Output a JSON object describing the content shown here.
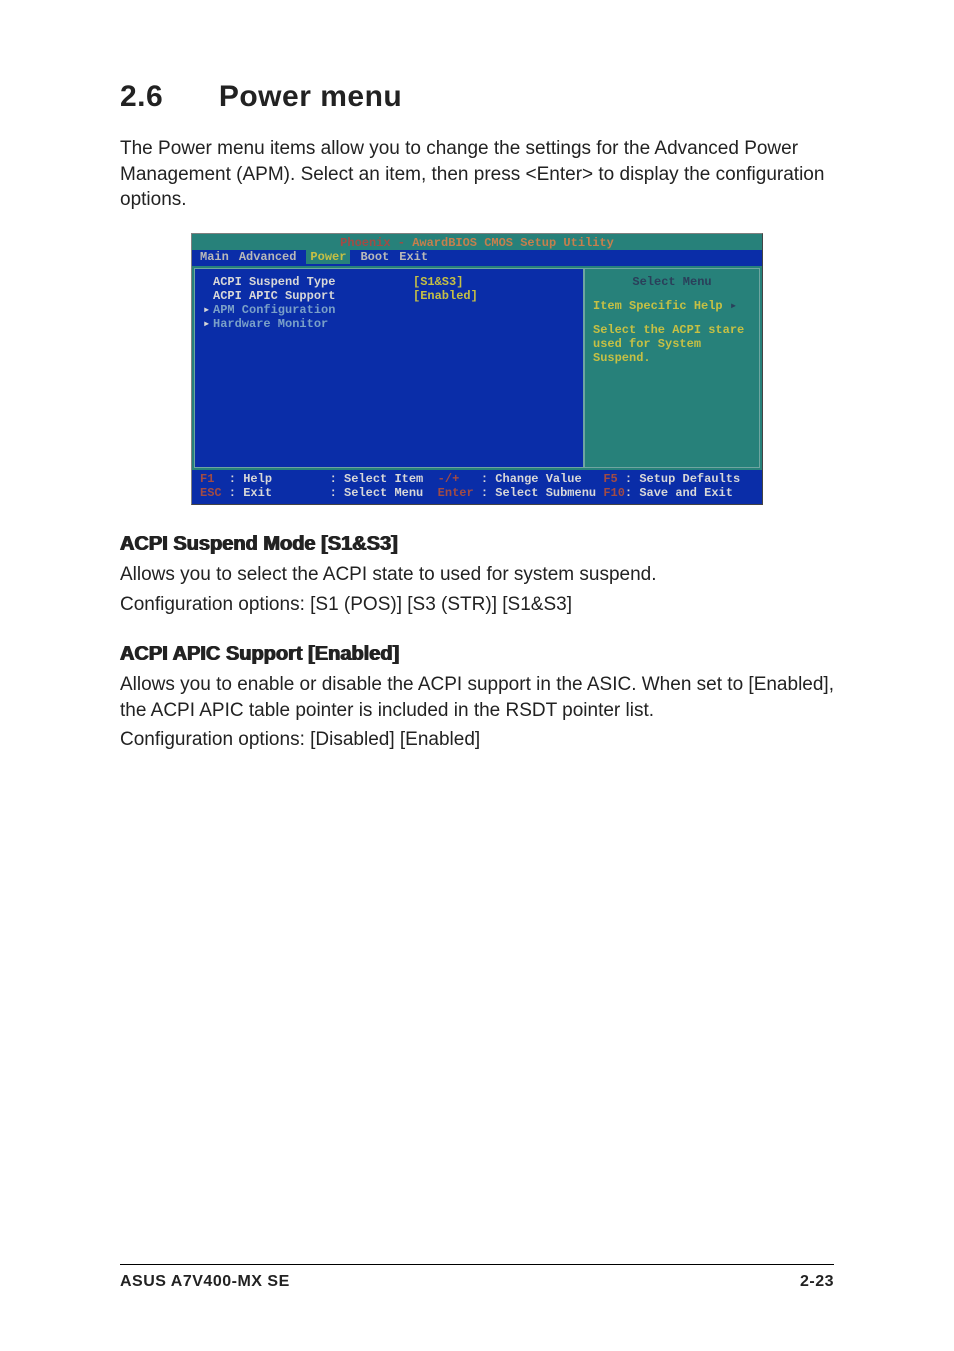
{
  "heading": {
    "number": "2.6",
    "title": "Power menu"
  },
  "intro": "The Power menu items allow you to change the settings for the Advanced Power Management (APM). Select an item, then press <Enter> to display the configuration options.",
  "bios": {
    "title_left": "Phoenix - ",
    "title_right": "AwardBIOS CMOS Setup Utility",
    "menus": {
      "main": "Main",
      "advanced": "Advanced",
      "power": "Power",
      "boot": "Boot",
      "exit": "Exit"
    },
    "rows": [
      {
        "marker": "",
        "label": "ACPI Suspend Type",
        "value": "[S1&S3]",
        "class": "hi"
      },
      {
        "marker": "",
        "label": "ACPI APIC Support",
        "value": "[Enabled]",
        "class": "hi"
      },
      {
        "marker": "▸",
        "label": "APM Configuration",
        "value": "",
        "class": "dim"
      },
      {
        "marker": "▸",
        "label": "Hardware Monitor",
        "value": "",
        "class": "dim"
      }
    ],
    "help": {
      "title": "Select Menu",
      "line1": "Item Specific Help ",
      "arrow": "▸",
      "body1": "Select the ACPI stare",
      "body2": "used for System",
      "body3": "Suspend."
    },
    "footer": {
      "r1": {
        "k1": "F1 ",
        "c1": " : Help        ",
        "c2": ": Select Item  ",
        "k2": "-/+   ",
        "c3": ": Change Value   ",
        "k3": "F5 ",
        "c4": ": Setup Defaults"
      },
      "r2": {
        "k1": "ESC",
        "c1": " : Exit        ",
        "c2": ": Select Menu  ",
        "k2": "Enter ",
        "c3": ": Select Submenu ",
        "k3": "F10",
        "c4": ": Save and Exit"
      }
    }
  },
  "sections": [
    {
      "title": "ACPI Suspend Mode [S1&S3]",
      "body1": "Allows you to select the ACPI state to used for system suspend.",
      "body2": "Configuration options: [S1 (POS)] [S3 (STR)] [S1&S3]"
    },
    {
      "title": "ACPI APIC Support [Enabled]",
      "body1": "Allows you to enable or disable the ACPI support in the ASIC. When set to [Enabled], the ACPI APIC table pointer is included in the RSDT pointer list.",
      "body2": "Configuration options: [Disabled] [Enabled]"
    }
  ],
  "footer": {
    "left": "ASUS A7V400-MX SE",
    "right": "2-23"
  }
}
